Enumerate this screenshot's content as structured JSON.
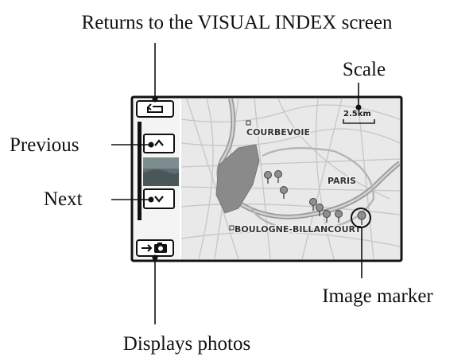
{
  "callouts": {
    "return_label": "Returns to the VISUAL INDEX screen",
    "scale_label": "Scale",
    "previous_label": "Previous",
    "next_label": "Next",
    "marker_label": "Image marker",
    "photos_label": "Displays photos"
  },
  "map": {
    "places": {
      "courbevoie": "COURBEVOIE",
      "paris": "PARIS",
      "boulogne": "BOULOGNE-BILLANCOURT"
    },
    "scale_text": "2.5km"
  },
  "icons": {
    "return": "return-arrow-icon",
    "previous": "chevron-up-icon",
    "next": "chevron-down-icon",
    "photos": "arrow-camera-icon",
    "marker": "map-pin-icon"
  },
  "colors": {
    "frame": "#111111",
    "map_background": "#e9e9e9",
    "park_fill": "#8a8a8a",
    "river": "#9a9a9a",
    "pin": "#8f8f8f"
  }
}
